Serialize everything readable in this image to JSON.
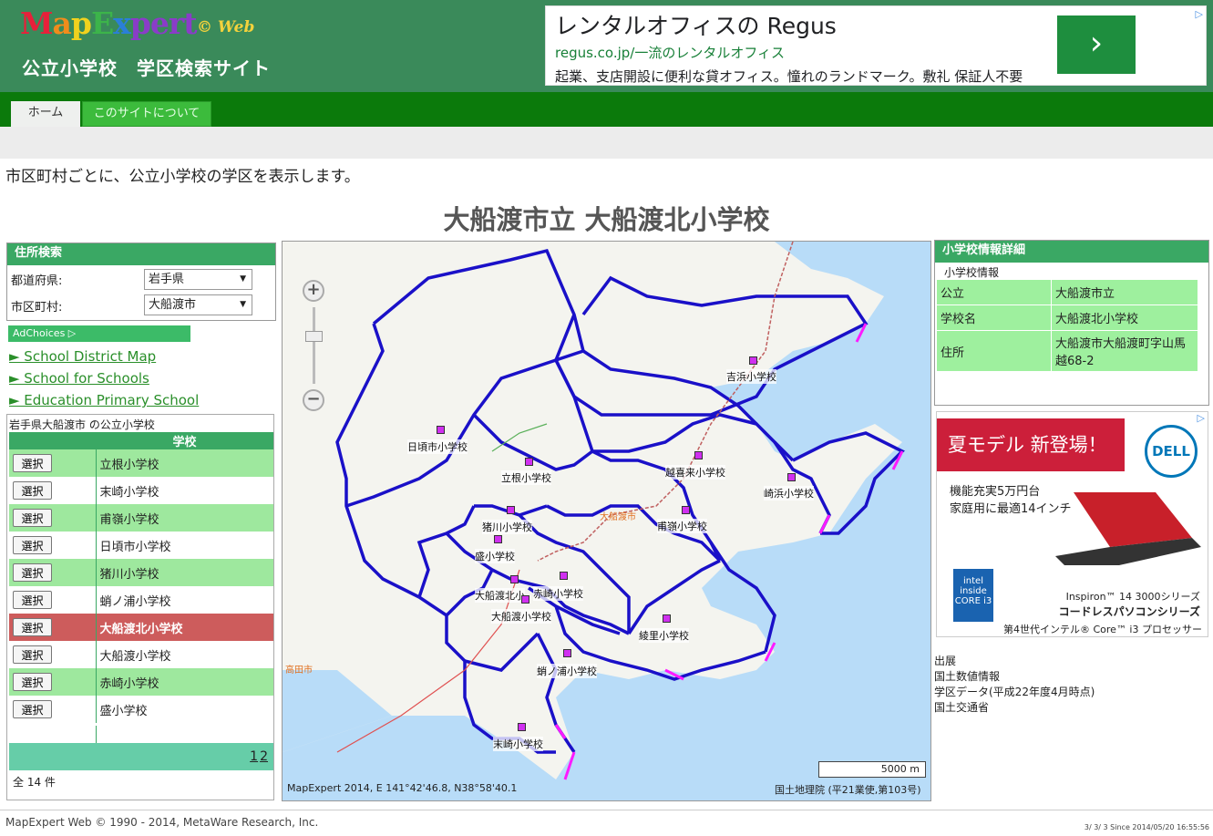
{
  "header": {
    "logo_parts": [
      "M",
      "a",
      "p",
      "E",
      "x",
      "pert"
    ],
    "logo_suffix": "© Web",
    "site_title": "公立小学校　学区検索サイト"
  },
  "top_ad": {
    "title": "レンタルオフィスの Regus",
    "url": "regus.co.jp/一流のレンタルオフィス",
    "description": "起業、支店開設に便利な貸オフィス。憧れのランドマーク。敷礼 保証人不要",
    "arrow": "›",
    "adchoices_icon": "▷"
  },
  "nav": {
    "tabs": [
      {
        "label": "ホーム",
        "active": true
      },
      {
        "label": "このサイトについて",
        "active": false
      }
    ]
  },
  "intro_text": "市区町村ごとに、公立小学校の学区を表示します。",
  "page_title": "大船渡市立 大船渡北小学校",
  "address_search": {
    "title": "住所検索",
    "prefecture_label": "都道府県:",
    "prefecture_value": "岩手県",
    "city_label": "市区町村:",
    "city_value": "大船渡市"
  },
  "ad_links": {
    "adchoices": "AdChoices ▷",
    "links": [
      "► School District Map",
      "► School for Schools",
      "► Education Primary School"
    ]
  },
  "school_list": {
    "caption": "岩手県大船渡市 の公立小学校",
    "column_header": "学校",
    "select_label": "選択",
    "rows": [
      {
        "name": "立根小学校",
        "style": "green"
      },
      {
        "name": "末崎小学校",
        "style": "white"
      },
      {
        "name": "甫嶺小学校",
        "style": "green"
      },
      {
        "name": "日頃市小学校",
        "style": "white"
      },
      {
        "name": "猪川小学校",
        "style": "green"
      },
      {
        "name": "蛸ノ浦小学校",
        "style": "white"
      },
      {
        "name": "大船渡北小学校",
        "style": "active"
      },
      {
        "name": "大船渡小学校",
        "style": "white"
      },
      {
        "name": "赤崎小学校",
        "style": "green"
      },
      {
        "name": "盛小学校",
        "style": "white"
      }
    ],
    "pages": [
      "1",
      "2"
    ],
    "total": "全 14 件"
  },
  "map": {
    "zoom_in": "+",
    "zoom_out": "−",
    "scale": "5000 m",
    "coords": "MapExpert 2014,  E 141°42'46.8, N38°58'40.1",
    "attribution": "国土地理院 (平21業使,第103号)",
    "place_names": [
      "大船渡市",
      "高田市"
    ],
    "school_labels": [
      "吉浜小学校",
      "日頃市小学校",
      "越喜来小学校",
      "立根小学校",
      "崎浜小学校",
      "猪川小学校",
      "甫嶺小学校",
      "盛小学校",
      "大船渡北小",
      "赤崎小学校",
      "大船渡小学校",
      "綾里小学校",
      "蛸ノ浦小学校",
      "末崎小学校"
    ]
  },
  "details": {
    "title": "小学校情報詳細",
    "subtitle": "小学校情報",
    "rows": [
      {
        "key": "公立",
        "value": "大船渡市立"
      },
      {
        "key": "学校名",
        "value": "大船渡北小学校"
      },
      {
        "key": "住所",
        "value": "大船渡市大船渡町字山馬越68-2"
      }
    ]
  },
  "side_ad": {
    "headline": "夏モデル 新登場！",
    "brand": "DELL",
    "line1": "機能充実5万円台",
    "line2": "家庭用に最適14インチ",
    "intel": "intel inside CORE i3",
    "product1": "Inspiron™ 14 3000シリーズ",
    "product2": "コードレスパソコンシリーズ",
    "product3": "第4世代インテル® Core™ i3 プロセッサー",
    "adchoices_icon": "▷"
  },
  "sources": [
    "出展",
    "国土数値情報",
    "学区データ(平成22年度4月時点)",
    "国土交通省"
  ],
  "footer": {
    "copyright": "MapExpert Web © 1990 - 2014, MetaWare Research, Inc.",
    "counter": "3/ 3/ 3 Since 2014/05/20 16:55:56"
  },
  "colors": {
    "header_bg": "#3a8a5a",
    "nav_bg": "#0b7a0b",
    "table_green": "#9ee89e",
    "active_row": "#cd5c5c",
    "boundary": "#1a10c8",
    "sea": "#b8dcf8"
  }
}
